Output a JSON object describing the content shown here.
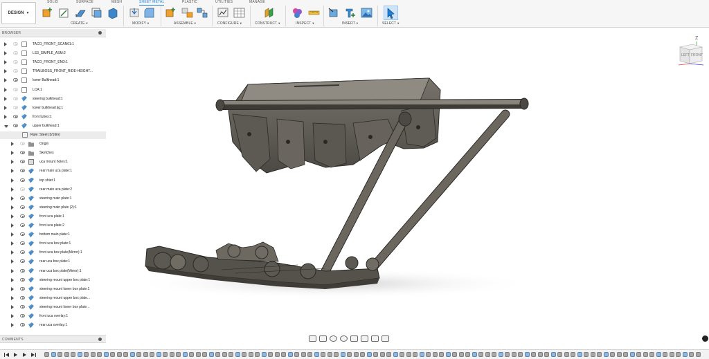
{
  "app": {
    "workspace_button": "DESIGN"
  },
  "tabs": [
    "SOLID",
    "SURFACE",
    "MESH",
    "SHEET METAL",
    "PLASTIC",
    "UTILITIES",
    "MANAGE"
  ],
  "active_tab": "SHEET METAL",
  "toolbar_groups": [
    "CREATE",
    "MODIFY",
    "ASSEMBLE",
    "CONFIGURE",
    "CONSTRUCT",
    "INSPECT",
    "INSERT",
    "SELECT"
  ],
  "browser": {
    "header": "BROWSER",
    "rule_label": "Rule: Steel (3/16in)",
    "items": [
      {
        "label": "TACO_FRONT_SCAN01:1",
        "icon": "component-icon",
        "visible": false
      },
      {
        "label": "LS3_SIMPLE_ASM:2",
        "icon": "component-icon",
        "visible": false
      },
      {
        "label": "TACO_FRONT_END:1",
        "icon": "component-icon",
        "visible": false
      },
      {
        "label": "TRAILBOSS_FRONT_RIDE-HEIGHT...",
        "icon": "component-icon",
        "visible": false
      },
      {
        "label": "lower Bulkhead:1",
        "icon": "component-icon",
        "visible": true
      },
      {
        "label": "LCA:1",
        "icon": "component-icon",
        "visible": false
      },
      {
        "label": "steering bulkhead:1",
        "icon": "sheet-body-icon",
        "visible": false
      },
      {
        "label": "lower bulkhead jig:1",
        "icon": "sheet-body-icon",
        "visible": false
      },
      {
        "label": "front tubes:1",
        "icon": "sheet-body-icon",
        "visible": true
      },
      {
        "label": "upper bulkhead:1",
        "icon": "sheet-body-icon",
        "visible": true
      },
      {
        "label": "Origin",
        "icon": "folder-icon",
        "visible": false
      },
      {
        "label": "Sketches",
        "icon": "folder-icon",
        "visible": true
      },
      {
        "label": "uca mount holes:1",
        "icon": "holes-icon",
        "visible": true
      },
      {
        "label": "rear main uca plate:1",
        "icon": "sheet-body-icon",
        "visible": true
      },
      {
        "label": "top shiet:1",
        "icon": "sheet-body-icon",
        "visible": true
      },
      {
        "label": "rear main uca plate:2",
        "icon": "sheet-body-icon",
        "visible": false
      },
      {
        "label": "steering main plate:1",
        "icon": "sheet-body-icon",
        "visible": true
      },
      {
        "label": "steering main plate (2):1",
        "icon": "sheet-body-icon",
        "visible": true
      },
      {
        "label": "front uca plate:1",
        "icon": "sheet-body-icon",
        "visible": true
      },
      {
        "label": "front uca plate:2",
        "icon": "sheet-body-icon",
        "visible": true
      },
      {
        "label": "bottom main plate:1",
        "icon": "sheet-body-icon",
        "visible": true
      },
      {
        "label": "front uca box plate:1",
        "icon": "sheet-body-icon",
        "visible": true
      },
      {
        "label": "front uca box plate(Mirror):1",
        "icon": "sheet-body-icon",
        "visible": true
      },
      {
        "label": "rear uca box plate:1",
        "icon": "sheet-body-icon",
        "visible": true
      },
      {
        "label": "rear uca box plate(Mirror):1",
        "icon": "sheet-body-icon",
        "visible": true
      },
      {
        "label": "steering mount upper box plate:1",
        "icon": "sheet-body-icon",
        "visible": true
      },
      {
        "label": "steering mount lower box plate:1",
        "icon": "sheet-body-icon",
        "visible": true
      },
      {
        "label": "steering mount upper box plate...",
        "icon": "sheet-body-icon",
        "visible": true
      },
      {
        "label": "steering mount lower box plate...",
        "icon": "sheet-body-icon",
        "visible": true
      },
      {
        "label": "front uca overlay:1",
        "icon": "sheet-body-icon",
        "visible": true
      },
      {
        "label": "rear uca overlay:1",
        "icon": "sheet-body-icon",
        "visible": true
      }
    ]
  },
  "comments": {
    "header": "COMMENTS"
  },
  "viewcube": {
    "top": "Z",
    "left_face": "LEFT",
    "front_face": "FRONT"
  },
  "colors": {
    "accent": "#1e7fd8",
    "model": "#66625a",
    "model_light": "#8a857c"
  }
}
